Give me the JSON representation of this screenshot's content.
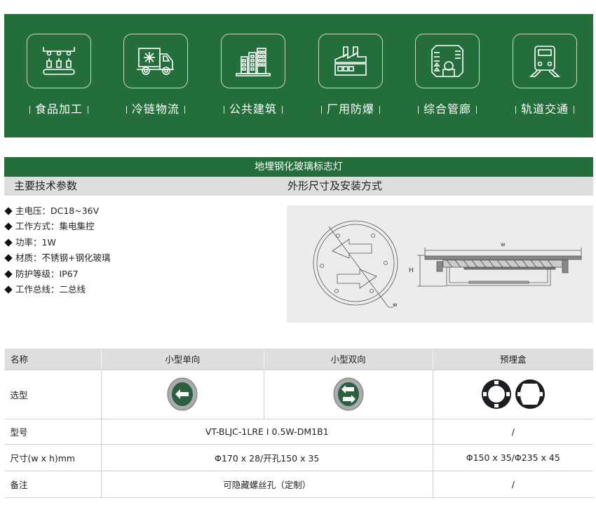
{
  "banner": {
    "background_color": "#246e3c",
    "applications": [
      {
        "label": "食品加工",
        "icon": "food-processing-conveyor-icon"
      },
      {
        "label": "冷链物流",
        "icon": "refrigerated-truck-icon"
      },
      {
        "label": "公共建筑",
        "icon": "public-buildings-icon"
      },
      {
        "label": "厂用防爆",
        "icon": "factory-icon"
      },
      {
        "label": "综合管廊",
        "icon": "utility-tunnel-icon"
      },
      {
        "label": "轨道交通",
        "icon": "train-icon"
      }
    ]
  },
  "product": {
    "title": "地埋钢化玻璃标志灯",
    "specs_heading": "主要技术参数",
    "drawing_heading": "外形尺寸及安装方式",
    "specs": [
      "主电压：DC18~36V",
      "工作方式：集电集控",
      "功率：1W",
      "材质：不锈钢+钢化玻璃",
      "防护等级：IP67",
      "工作总线：二总线"
    ],
    "drawing_labels": {
      "width_top": "w",
      "height": "H",
      "width_diag": "w"
    }
  },
  "table": {
    "headers": [
      "名称",
      "小型单向",
      "小型双向",
      "预埋盒"
    ],
    "selection_row": {
      "label": "选型",
      "images": [
        "single-direction-arrow-light",
        "double-direction-arrow-light",
        "embedded-box-rings"
      ]
    },
    "rows": [
      {
        "label": "型号",
        "main": "VT-BLJC-1LRE I 0.5W-DM1B1",
        "box": "/"
      },
      {
        "label": "尺寸(w x h)mm",
        "main": "Φ170 x 28/开孔150 x 35",
        "box": "Φ150 x 35/Φ235 x 45"
      },
      {
        "label": "备注",
        "main": "可隐藏螺丝孔（定制）",
        "box": "/"
      }
    ]
  }
}
